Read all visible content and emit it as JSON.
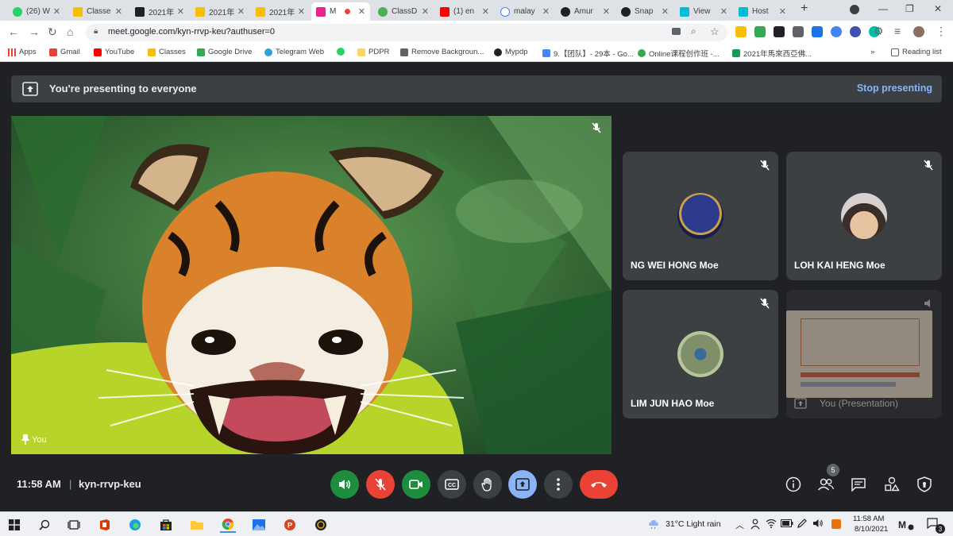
{
  "browser": {
    "tabs": [
      {
        "label": "(26) W",
        "color": "#25d366"
      },
      {
        "label": "Classe",
        "color": "#fbbc04"
      },
      {
        "label": "2021年",
        "color": "#202124"
      },
      {
        "label": "2021年",
        "color": "#fbbc04"
      },
      {
        "label": "2021年",
        "color": "#fbbc04"
      },
      {
        "label": "M",
        "color": "#e52592",
        "active": true
      },
      {
        "label": "ClassD",
        "color": "#4caf50"
      },
      {
        "label": "(1) en",
        "color": "#ff0000"
      },
      {
        "label": "malay",
        "color": "#4285f4"
      },
      {
        "label": "Amur",
        "color": "#202124"
      },
      {
        "label": "Snap",
        "color": "#202124"
      },
      {
        "label": "View",
        "color": "#00bcd4"
      },
      {
        "label": "Host",
        "color": "#00bcd4"
      }
    ],
    "url": "meet.google.com/kyn-rrvp-keu?authuser=0",
    "bookmarks": [
      {
        "label": "Apps",
        "color": "#ea4335"
      },
      {
        "label": "Gmail",
        "color": "#ea4335"
      },
      {
        "label": "YouTube",
        "color": "#ff0000"
      },
      {
        "label": "Classes",
        "color": "#fbbc04"
      },
      {
        "label": "Google Drive",
        "color": "#34a853"
      },
      {
        "label": "Telegram Web",
        "color": "#2aa3df"
      },
      {
        "label": "",
        "color": "#25d366"
      },
      {
        "label": "PDPR",
        "color": "#fdd663"
      },
      {
        "label": "Remove Backgroun...",
        "color": "#5f6368"
      },
      {
        "label": "Mypdp",
        "color": "#202124"
      },
      {
        "label": "9.【团队】- 29本 - Go...",
        "color": "#4285f4"
      },
      {
        "label": "Online课程创作班 -...",
        "color": "#34a853"
      },
      {
        "label": "2021年馬來西亞佛...",
        "color": "#0f9d58"
      }
    ],
    "reading_list": "Reading list"
  },
  "meet": {
    "banner_text": "You're presenting to everyone",
    "stop_presenting": "Stop presenting",
    "main_label": "You",
    "participants": [
      {
        "name": "NG WEI HONG Moe"
      },
      {
        "name": "LOH KAI HENG Moe"
      },
      {
        "name": "LIM JUN HAO Moe"
      },
      {
        "name": "You (Presentation)"
      }
    ],
    "time": "11:58 AM",
    "separator": "|",
    "meeting_code": "kyn-rrvp-keu",
    "people_count": "5",
    "colors": {
      "accent_blue": "#8ab4f8",
      "green": "#1e8e3e",
      "red": "#ea4335"
    }
  },
  "taskbar": {
    "weather": "31°C  Light rain",
    "time": "11:58 AM",
    "date": "8/10/2021",
    "notifications": "3"
  }
}
